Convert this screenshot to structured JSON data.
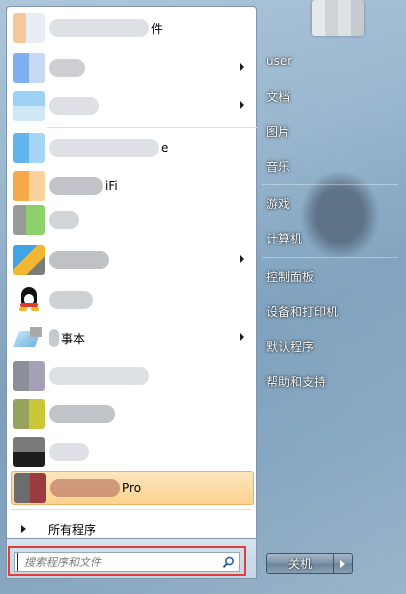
{
  "colors": {
    "selection": "#fbd28f",
    "highlight_border": "#e23b3b",
    "right_text": "#ffffff"
  },
  "programs": [
    {
      "label": "件",
      "has_arrow": false,
      "icon": "blurred-app-icon"
    },
    {
      "label": "",
      "has_arrow": true,
      "icon": "blurred-app-icon"
    },
    {
      "label": "",
      "has_arrow": true,
      "icon": "blurred-app-icon"
    },
    {
      "label": "e",
      "has_arrow": false,
      "icon": "blurred-app-icon"
    },
    {
      "label": "iFi",
      "has_arrow": false,
      "icon": "blurred-app-icon"
    },
    {
      "label": "",
      "has_arrow": false,
      "icon": "blurred-app-icon"
    },
    {
      "label": "",
      "has_arrow": true,
      "icon": "blurred-app-icon"
    },
    {
      "label": "",
      "has_arrow": false,
      "icon": "qq-penguin-icon"
    },
    {
      "label": "事本",
      "has_arrow": true,
      "icon": "notepad-icon"
    },
    {
      "label": "",
      "has_arrow": false,
      "icon": "blurred-app-icon"
    },
    {
      "label": "",
      "has_arrow": false,
      "icon": "blurred-app-icon"
    },
    {
      "label": "",
      "has_arrow": false,
      "icon": "blurred-app-icon"
    },
    {
      "label": "Pro",
      "has_arrow": false,
      "icon": "blurred-app-icon",
      "selected": true
    }
  ],
  "all_programs_label": "所有程序",
  "search": {
    "placeholder": "搜索程序和文件"
  },
  "right_pane": {
    "items": [
      {
        "label": "user"
      },
      {
        "label": "文档"
      },
      {
        "label": "图片"
      },
      {
        "label": "音乐"
      },
      {
        "label": "游戏"
      },
      {
        "label": "计算机"
      },
      {
        "label": "控制面板"
      },
      {
        "label": "设备和打印机"
      },
      {
        "label": "默认程序"
      },
      {
        "label": "帮助和支持"
      }
    ]
  },
  "shutdown": {
    "label": "关机"
  }
}
